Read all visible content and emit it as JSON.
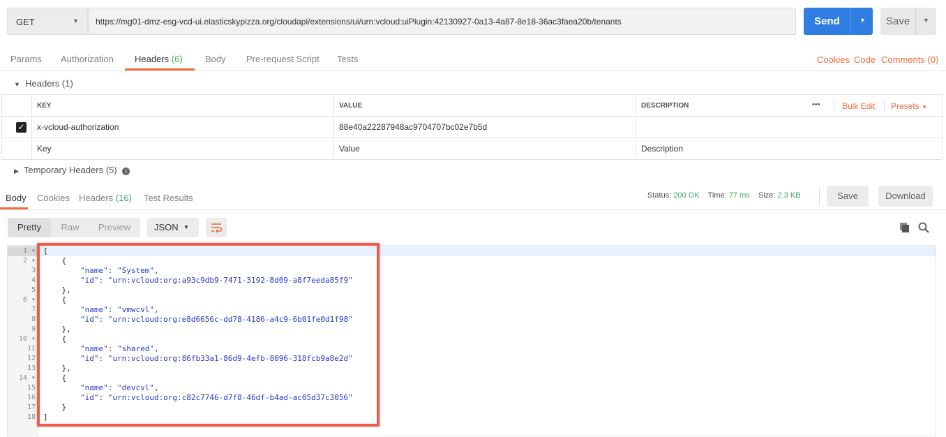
{
  "request": {
    "method": "GET",
    "url": "https://mg01-dmz-esg-vcd-ui.elasticskypizza.org/cloudapi/extensions/ui/urn:vcloud:uiPlugin:42130927-0a13-4a87-8e18-36ac3faea20b/tenants",
    "send_label": "Send",
    "save_label": "Save"
  },
  "req_tabs": [
    {
      "label": "Params"
    },
    {
      "label": "Authorization"
    },
    {
      "label": "Headers",
      "count": "(6)"
    },
    {
      "label": "Body"
    },
    {
      "label": "Pre-request Script"
    },
    {
      "label": "Tests"
    }
  ],
  "req_links": {
    "cookies": "Cookies",
    "code": "Code",
    "comments": "Comments (0)"
  },
  "headers_section": {
    "title": "Headers (1)",
    "columns": {
      "key": "KEY",
      "value": "VALUE",
      "description": "DESCRIPTION"
    },
    "bulk_edit": "Bulk Edit",
    "presets": "Presets",
    "more": "•••",
    "rows": [
      {
        "checked": true,
        "key": "x-vcloud-authorization",
        "value": "88e40a22287948ac9704707bc02e7b5d",
        "description": ""
      }
    ],
    "placeholders": {
      "key": "Key",
      "value": "Value",
      "description": "Description"
    }
  },
  "temp_headers": "Temporary Headers (5)",
  "resp_tabs": [
    {
      "label": "Body"
    },
    {
      "label": "Cookies"
    },
    {
      "label": "Headers",
      "count": "(16)"
    },
    {
      "label": "Test Results"
    }
  ],
  "status": {
    "status_label": "Status:",
    "status": "200 OK",
    "time_label": "Time:",
    "time": "77 ms",
    "size_label": "Size:",
    "size": "2.3 KB",
    "save": "Save",
    "download": "Download"
  },
  "view": {
    "modes": [
      "Pretty",
      "Raw",
      "Preview"
    ],
    "format": "JSON"
  },
  "colors": {
    "accent": "#f26b3a",
    "send": "#2f7de1",
    "success": "#3fa76a",
    "highlight": "#ef5a4a"
  },
  "body_lines": [
    "[",
    "    {",
    "        \"name\": \"System\",",
    "        \"id\": \"urn:vcloud:org:a93c9db9-7471-3192-8d09-a8f7eeda85f9\"",
    "    },",
    "    {",
    "        \"name\": \"vmwcvl\",",
    "        \"id\": \"urn:vcloud:org:e8d6656c-dd78-4186-a4c9-6b01fe0d1f98\"",
    "    },",
    "    {",
    "        \"name\": \"shared\",",
    "        \"id\": \"urn:vcloud:org:86fb33a1-86d9-4efb-8096-318fcb9a8e2d\"",
    "    },",
    "    {",
    "        \"name\": \"devcvl\",",
    "        \"id\": \"urn:vcloud:org:c82c7746-d7f8-46df-b4ad-ac05d37c3056\"",
    "    }",
    "]"
  ]
}
